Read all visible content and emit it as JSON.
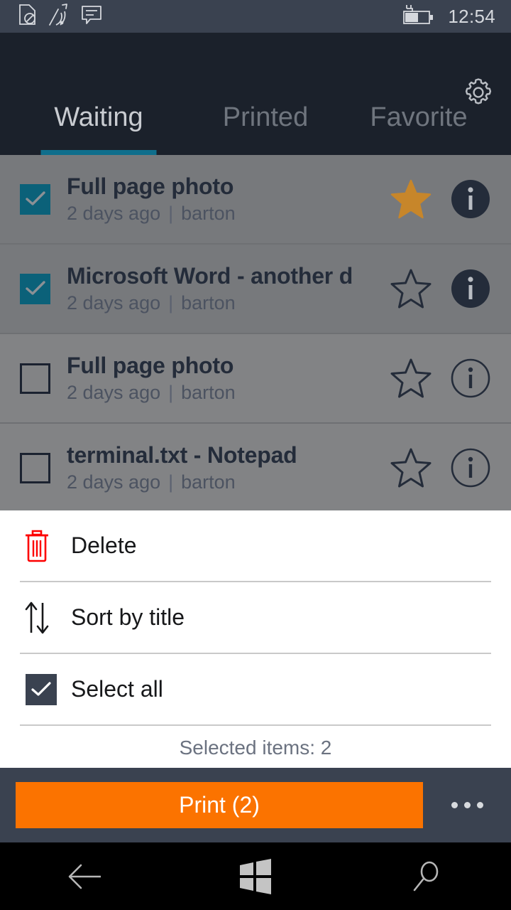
{
  "status_bar": {
    "icons": [
      "sim-missing-icon",
      "wifi-signal-icon",
      "sms-message-icon"
    ],
    "battery_icon": "battery-charging-icon",
    "clock": "12:54"
  },
  "header": {
    "settings_icon": "gear-icon",
    "tabs": [
      {
        "label": "Waiting",
        "active": true
      },
      {
        "label": "Printed",
        "active": false
      },
      {
        "label": "Favorite",
        "active": false
      }
    ],
    "active_tab_color": "#0f6e8c"
  },
  "job_list": {
    "jobs": [
      {
        "title": "Full page photo",
        "time": "2 days ago",
        "separator": "|",
        "user": "barton",
        "checked": true,
        "favorite": true,
        "info_filled": true
      },
      {
        "title": "Microsoft Word - another d",
        "time": "2 days ago",
        "separator": "|",
        "user": "barton",
        "checked": true,
        "favorite": false,
        "info_filled": true
      },
      {
        "title": "Full page photo",
        "time": "2 days ago",
        "separator": "|",
        "user": "barton",
        "checked": false,
        "favorite": false,
        "info_filled": false
      },
      {
        "title": "terminal.txt - Notepad",
        "time": "2 days ago",
        "separator": "|",
        "user": "barton",
        "checked": false,
        "favorite": false,
        "info_filled": false
      }
    ],
    "checkbox_checked_color": "#0b6179",
    "star_filled_color": "#c7862a"
  },
  "sheet": {
    "delete": {
      "label": "Delete",
      "icon": "trash-icon",
      "icon_color": "#fd0000"
    },
    "sort": {
      "label": "Sort by title",
      "icon": "sort-arrows-icon"
    },
    "select_all": {
      "label": "Select all",
      "icon": "checkmark-icon",
      "checked": true
    },
    "selected_count_text": "Selected items: 2"
  },
  "action_bar": {
    "print_label": "Print (2)",
    "print_color": "#fb7300",
    "overflow_icon": "more-dots-icon"
  },
  "nav_bar": {
    "back_icon": "back-arrow-icon",
    "start_icon": "windows-logo-icon",
    "search_icon": "search-icon"
  }
}
